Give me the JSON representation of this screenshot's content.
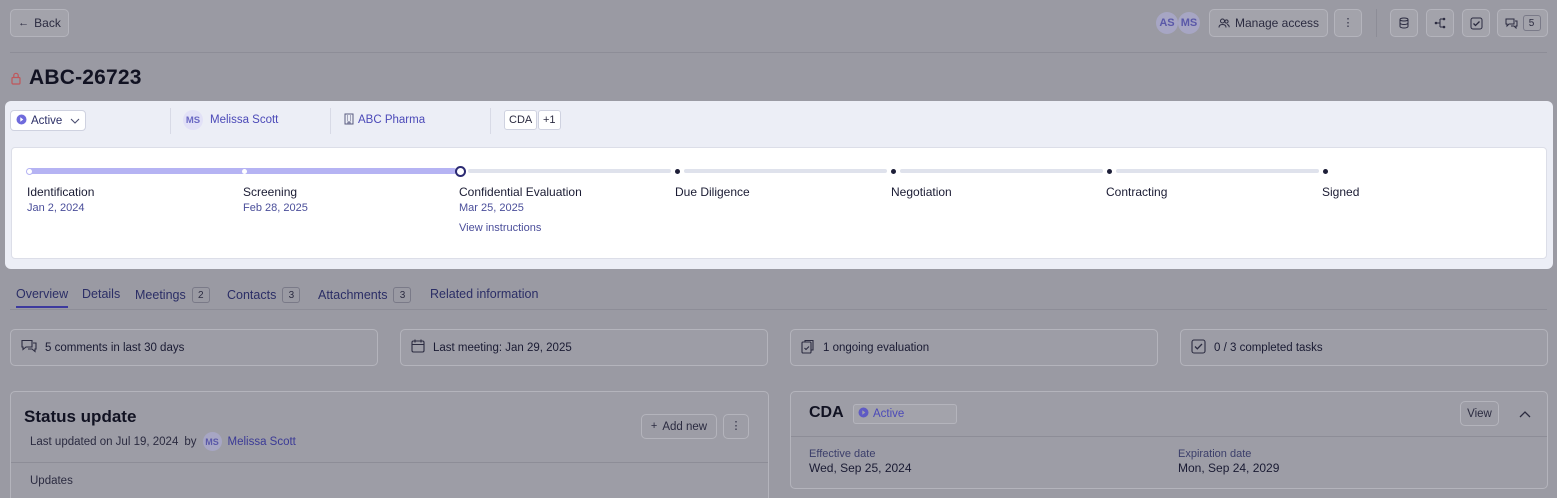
{
  "header": {
    "back_label": "Back",
    "avatars": [
      "AS",
      "MS"
    ],
    "manage_access_label": "Manage access",
    "comments_count": "5"
  },
  "record": {
    "title": "ABC-26723"
  },
  "meta": {
    "status": "Active",
    "owner_initials": "MS",
    "owner_name": "Melissa Scott",
    "company": "ABC Pharma",
    "tag": "CDA",
    "tag_more": "+1"
  },
  "stages": [
    {
      "name": "Identification",
      "date": "Jan 2, 2024"
    },
    {
      "name": "Screening",
      "date": "Feb 28, 2025"
    },
    {
      "name": "Confidential Evaluation",
      "date": "Mar 25, 2025",
      "link": "View instructions"
    },
    {
      "name": "Due Diligence"
    },
    {
      "name": "Negotiation"
    },
    {
      "name": "Contracting"
    },
    {
      "name": "Signed"
    }
  ],
  "tabs": [
    {
      "label": "Overview"
    },
    {
      "label": "Details"
    },
    {
      "label": "Meetings",
      "count": "2"
    },
    {
      "label": "Contacts",
      "count": "3"
    },
    {
      "label": "Attachments",
      "count": "3"
    },
    {
      "label": "Related information"
    }
  ],
  "stats": [
    {
      "icon": "chat-icon",
      "text": "5 comments in last 30 days"
    },
    {
      "icon": "calendar-icon",
      "text": "Last meeting: Jan 29, 2025"
    },
    {
      "icon": "clipboard-icon",
      "text": "1 ongoing evaluation"
    },
    {
      "icon": "checkbox-icon",
      "text": "0 / 3 completed tasks"
    }
  ],
  "status_update": {
    "title": "Status update",
    "last_updated": "Last updated on Jul 19, 2024",
    "by": "by",
    "author_initials": "MS",
    "author": "Melissa Scott",
    "add_new_label": "Add new",
    "updates_label": "Updates"
  },
  "cda": {
    "title": "CDA",
    "status": "Active",
    "view_label": "View",
    "effective_label": "Effective date",
    "effective_value": "Wed, Sep 25, 2024",
    "expiration_label": "Expiration date",
    "expiration_value": "Mon, Sep 24, 2029"
  },
  "colors": {
    "accent": "#5b57c9",
    "progress_fill": "#b5b3f3",
    "overlay": "#9a9aa3"
  }
}
